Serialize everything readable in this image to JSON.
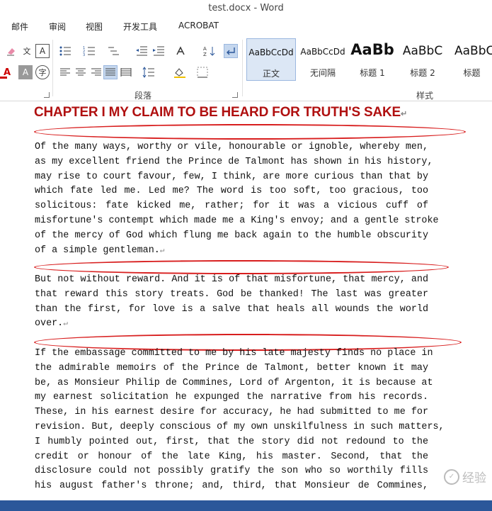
{
  "window": {
    "title": "test.docx - Word"
  },
  "menu": [
    "邮件",
    "审阅",
    "视图",
    "开发工具",
    "ACROBAT"
  ],
  "ribbon": {
    "group_paragraph": "段落",
    "group_styles": "样式",
    "styles": [
      {
        "sample": "AaBbCcDd",
        "name": "正文",
        "selected": true
      },
      {
        "sample": "AaBbCcDd",
        "name": "无间隔",
        "selected": false
      },
      {
        "sample": "AaBb",
        "name": "标题 1",
        "selected": false
      },
      {
        "sample": "AaBbC",
        "name": "标题 2",
        "selected": false
      },
      {
        "sample": "AaBbC",
        "name": "标题",
        "selected": false
      }
    ],
    "phonetic_label": "文",
    "enclosed_char": "字"
  },
  "document": {
    "heading": "CHAPTER I MY CLAIM TO BE HEARD FOR TRUTH'S SAKE",
    "paragraphs": [
      [
        "Of the many ways, worthy or vile, honourable or ignoble, whereby men,",
        "as my excellent friend the Prince de Talmont has shown in his history,",
        "may rise to court favour, few, I think, are more curious than that by",
        "which fate led me. Led me? The word is too soft, too gracious, too",
        "solicitous: fate kicked me, rather; for it was a vicious cuff of",
        "misfortune's contempt which made me a King's envoy; and a gentle stroke",
        "of the mercy of God which flung me back again to the humble obscurity",
        "of a simple gentleman."
      ],
      [
        "But not without reward. And it is of that misfortune, that mercy, and",
        "that reward this story treats. God be thanked! The last was greater",
        "than the first, for love is a salve that heals all wounds the world",
        "over."
      ],
      [
        "If the embassage committed to me by his late majesty finds no place in",
        "the admirable memoirs of the Prince de Talmont, better known it may",
        "be, as Monsieur Philip de Commines, Lord of Argenton, it is because at",
        "my earnest solicitation he expunged the narrative from his records.",
        "These, in his earnest desire for accuracy, he had submitted to me for",
        "revision. But, deeply conscious of my own unskilfulness in such matters,",
        "I humbly pointed out, first, that the story did not redound to the",
        "credit or honour of the late King, his master. Second, that the",
        "disclosure could not possibly gratify the son who so worthily fills",
        "his august father's throne; and, third, that Monsieur de Commines,"
      ]
    ],
    "paragraph_mark": "↵"
  },
  "watermark": {
    "text": "经验"
  },
  "colors": {
    "heading": "#b01010",
    "annotation": "#d81e1e",
    "statusbar": "#2b579a",
    "selection": "#c5d7ee"
  }
}
